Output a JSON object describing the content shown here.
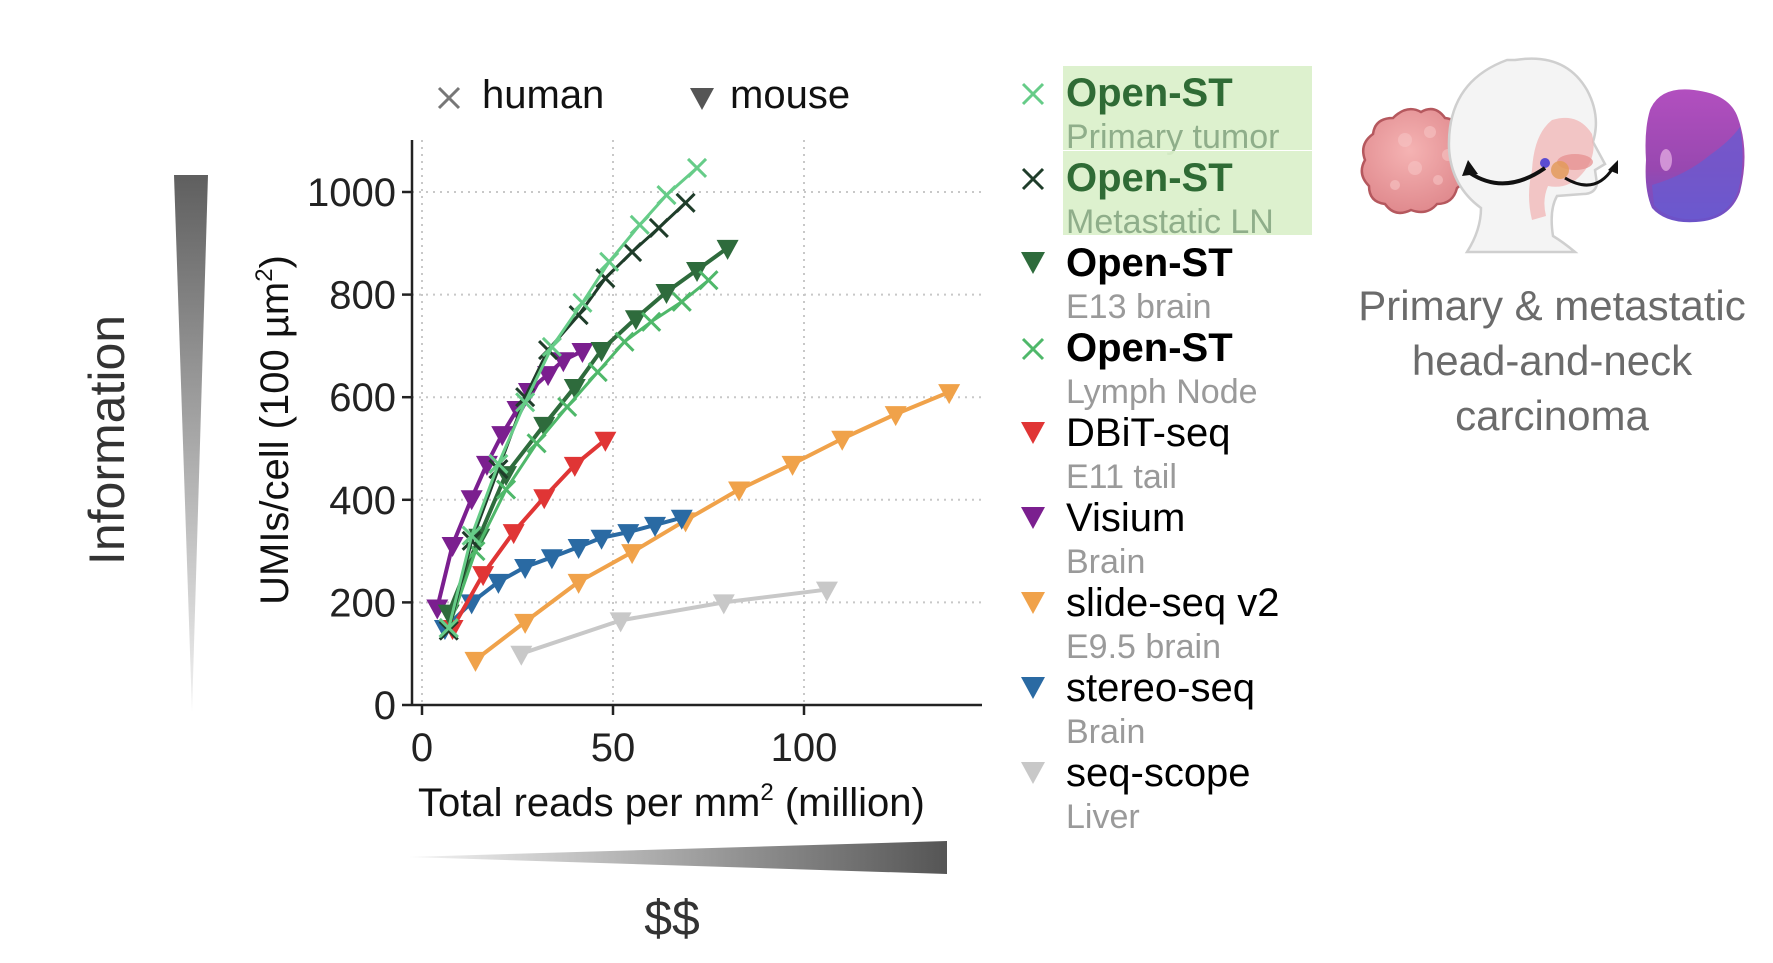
{
  "chart_data": {
    "type": "line",
    "title": "",
    "xlabel": "Total reads per mm² (million)",
    "xlabel_base": "Total reads per mm",
    "xlabel_sup": "2",
    "xlabel_tail": " (million)",
    "ylabel": "UMIs/cell (100 µm²)",
    "ylabel_base": "UMIs/cell (100 µm",
    "ylabel_sup": "2",
    "ylabel_tail": ")",
    "xlim": [
      0,
      145
    ],
    "ylim": [
      0,
      1080
    ],
    "xticks": [
      0,
      50,
      100
    ],
    "xtick_labels": [
      "0",
      "50",
      "100"
    ],
    "yticks": [
      0,
      200,
      400,
      600,
      800,
      1000
    ],
    "ytick_labels": [
      "0",
      "200",
      "400",
      "600",
      "800",
      "1000"
    ],
    "grid": true,
    "legend_placement": "right",
    "species_legend": [
      {
        "marker": "x",
        "label": "human",
        "color": "#777777"
      },
      {
        "marker": "triangle-down",
        "label": "mouse",
        "color": "#555555"
      }
    ],
    "series": [
      {
        "name": "Open-ST",
        "subtitle": "Primary tumor",
        "marker": "x",
        "color": "#66cc88",
        "highlight": true,
        "bold": true,
        "title_color": "#2f6b35",
        "x": [
          7,
          13,
          20,
          27,
          34,
          42,
          49,
          57,
          64,
          72
        ],
        "y": [
          150,
          330,
          470,
          590,
          698,
          784,
          864,
          936,
          994,
          1047
        ]
      },
      {
        "name": "Open-ST",
        "subtitle": "Metastatic LN",
        "marker": "x",
        "color": "#1f3d2a",
        "highlight": true,
        "bold": true,
        "title_color": "#2f6b35",
        "x": [
          7,
          13,
          20,
          27,
          33,
          41,
          48,
          55,
          62,
          69
        ],
        "y": [
          145,
          320,
          460,
          600,
          692,
          760,
          832,
          883,
          930,
          979
        ]
      },
      {
        "name": "Open-ST",
        "subtitle": "E13 brain",
        "marker": "triangle-down",
        "color": "#2e6b3c",
        "highlight": false,
        "bold": true,
        "title_color": "#000000",
        "x": [
          7,
          15,
          22,
          32,
          40,
          47,
          56,
          64,
          72,
          80
        ],
        "y": [
          180,
          328,
          450,
          546,
          620,
          692,
          754,
          805,
          848,
          891
        ]
      },
      {
        "name": "Open-ST",
        "subtitle": "Lymph Node",
        "marker": "x",
        "color": "#4fb86a",
        "highlight": false,
        "bold": true,
        "title_color": "#000000",
        "x": [
          7,
          14,
          22,
          30,
          38,
          46,
          53,
          60,
          68,
          75
        ],
        "y": [
          150,
          300,
          420,
          510,
          581,
          649,
          708,
          747,
          786,
          828
        ]
      },
      {
        "name": "DBiT-seq",
        "subtitle": "E11 tail",
        "marker": "triangle-down",
        "color": "#e03535",
        "highlight": false,
        "bold": false,
        "title_color": "#000000",
        "x": [
          8,
          16,
          24,
          32,
          40,
          48
        ],
        "y": [
          150,
          255,
          337,
          405,
          468,
          517
        ]
      },
      {
        "name": "Visium",
        "subtitle": "Brain",
        "marker": "triangle-down",
        "color": "#7b1f8f",
        "highlight": false,
        "bold": false,
        "title_color": "#000000",
        "x": [
          4,
          8,
          13,
          17,
          21,
          25,
          28,
          33,
          37,
          42
        ],
        "y": [
          190,
          312,
          403,
          470,
          528,
          577,
          612,
          645,
          672,
          690
        ]
      },
      {
        "name": "slide-seq v2",
        "subtitle": "E9.5 brain",
        "marker": "triangle-down",
        "color": "#f0a24a",
        "highlight": false,
        "bold": false,
        "title_color": "#000000",
        "x": [
          14,
          27,
          41,
          55,
          69,
          83,
          97,
          110,
          124,
          138
        ],
        "y": [
          88,
          162,
          240,
          298,
          360,
          420,
          470,
          519,
          567,
          610
        ]
      },
      {
        "name": "stereo-seq",
        "subtitle": "Brain",
        "marker": "triangle-down",
        "color": "#2a6aa3",
        "highlight": false,
        "bold": false,
        "title_color": "#000000",
        "x": [
          6,
          13,
          20,
          27,
          34,
          41,
          47,
          54,
          61,
          68
        ],
        "y": [
          150,
          200,
          240,
          269,
          288,
          308,
          326,
          337,
          351,
          365
        ]
      },
      {
        "name": "seq-scope",
        "subtitle": "Liver",
        "marker": "triangle-down",
        "color": "#c8c8c8",
        "highlight": false,
        "bold": false,
        "title_color": "#000000",
        "x": [
          26,
          52,
          79,
          106
        ],
        "y": [
          100,
          165,
          200,
          225
        ]
      }
    ]
  },
  "annotations": {
    "information_label": "Information",
    "cost_label": "$$"
  },
  "illustration": {
    "caption_lines": [
      "Primary & metastatic",
      "head-and-neck",
      "carcinoma"
    ],
    "icons": [
      "tumor-blob",
      "head-neck-profile",
      "lymph-node"
    ]
  }
}
